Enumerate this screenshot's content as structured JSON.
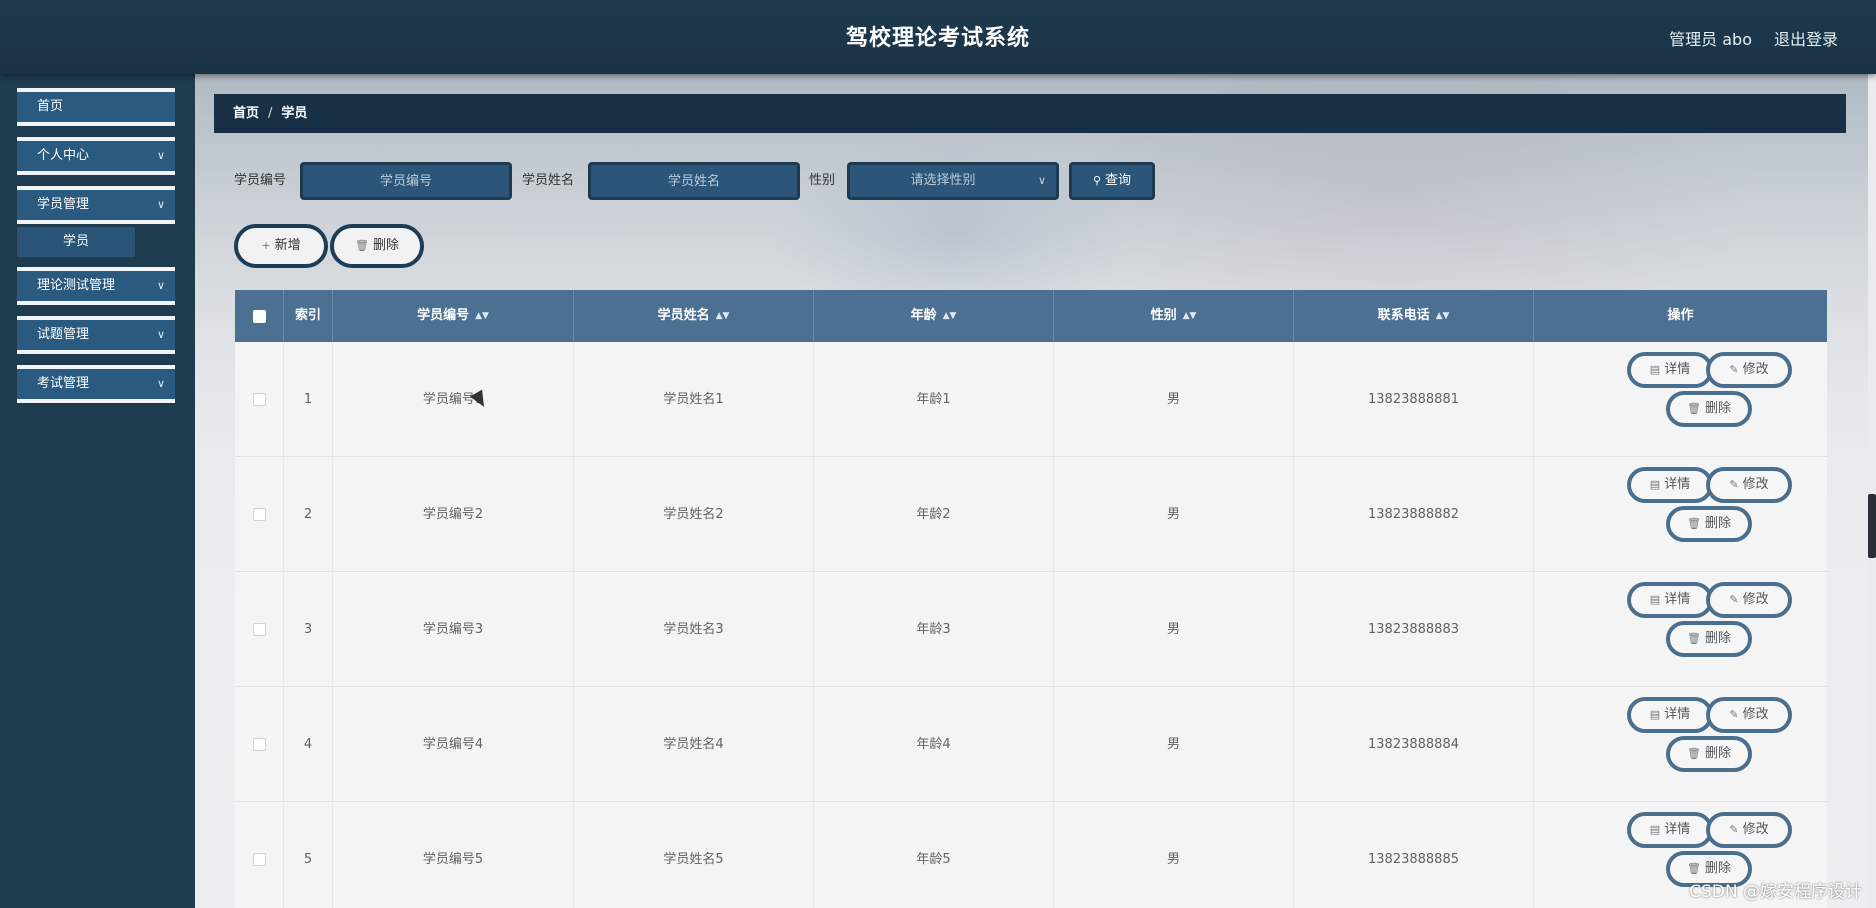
{
  "header": {
    "title": "驾校理论考试系统",
    "user": "管理员 abo",
    "logout": "退出登录"
  },
  "sidebar": {
    "items": [
      {
        "label": "首页",
        "chevron": false
      },
      {
        "label": "个人中心",
        "chevron": true
      },
      {
        "label": "学员管理",
        "chevron": true
      },
      {
        "label": "理论测试管理",
        "chevron": true
      },
      {
        "label": "试题管理",
        "chevron": true
      },
      {
        "label": "考试管理",
        "chevron": true
      }
    ],
    "sub_item": "学员"
  },
  "breadcrumb": {
    "home": "首页",
    "separator": "/",
    "current": "学员"
  },
  "search": {
    "id_label": "学员编号",
    "id_placeholder": "学员编号",
    "name_label": "学员姓名",
    "name_placeholder": "学员姓名",
    "gender_label": "性别",
    "gender_placeholder": "请选择性别",
    "query_label": "查询"
  },
  "toolbar": {
    "add_label": "新增",
    "delete_label": "删除"
  },
  "table": {
    "headers": {
      "index": "索引",
      "id": "学员编号",
      "name": "学员姓名",
      "age": "年龄",
      "gender": "性别",
      "phone": "联系电话",
      "actions": "操作"
    },
    "actions": {
      "detail": "详情",
      "edit": "修改",
      "delete": "删除"
    },
    "rows": [
      {
        "index": "1",
        "id": "学员编号1",
        "name": "学员姓名1",
        "age": "年龄1",
        "gender": "男",
        "phone": "13823888881"
      },
      {
        "index": "2",
        "id": "学员编号2",
        "name": "学员姓名2",
        "age": "年龄2",
        "gender": "男",
        "phone": "13823888882"
      },
      {
        "index": "3",
        "id": "学员编号3",
        "name": "学员姓名3",
        "age": "年龄3",
        "gender": "男",
        "phone": "13823888883"
      },
      {
        "index": "4",
        "id": "学员编号4",
        "name": "学员姓名4",
        "age": "年龄4",
        "gender": "男",
        "phone": "13823888884"
      },
      {
        "index": "5",
        "id": "学员编号5",
        "name": "学员姓名5",
        "age": "年龄5",
        "gender": "男",
        "phone": "13823888885"
      }
    ]
  },
  "watermark": "CSDN @嫁安程序设计",
  "colors": {
    "header_bg": "#1c3549",
    "sidebar_bg": "#1f3b50",
    "menu_bg": "#2b5a80",
    "table_header_bg": "#4b7091",
    "button_border": "#1d3d56"
  }
}
